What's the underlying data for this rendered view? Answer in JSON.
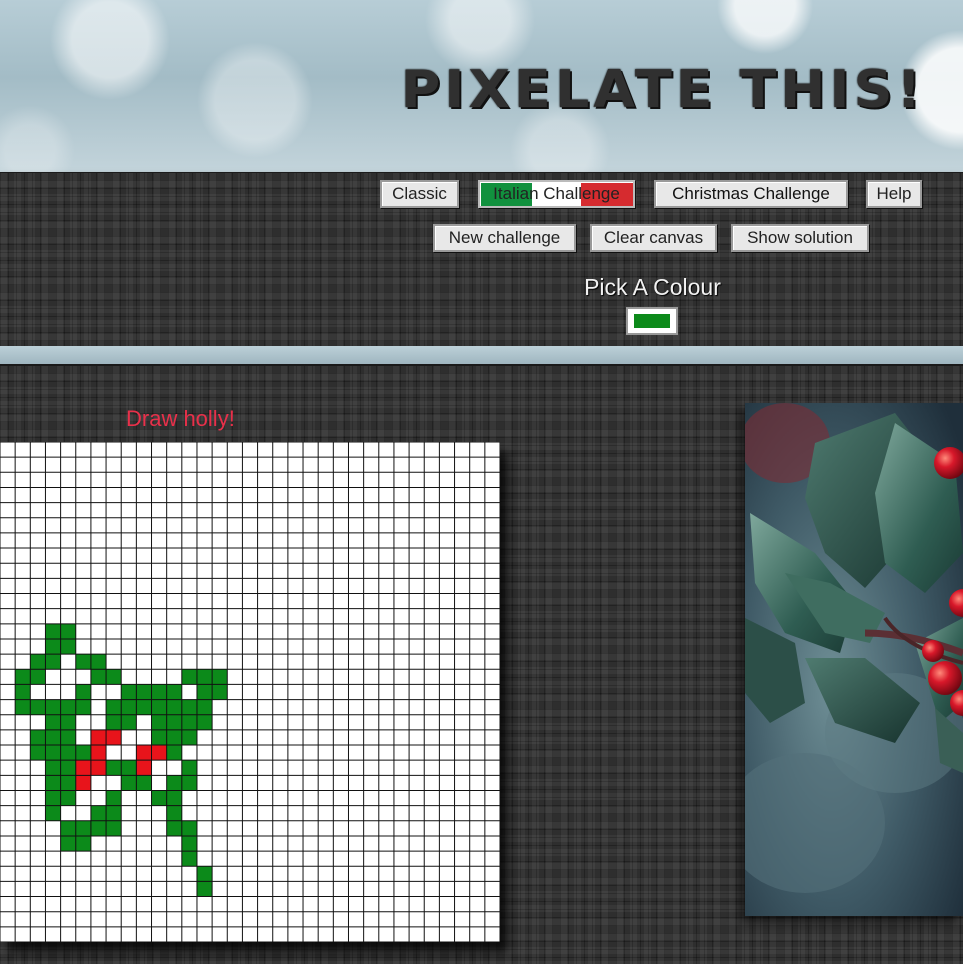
{
  "header": {
    "title": "PIXELATE THIS!"
  },
  "modes": [
    {
      "label": "Classic"
    },
    {
      "label": "Italian Challenge"
    },
    {
      "label": "Christmas Challenge"
    },
    {
      "label": "Help"
    }
  ],
  "actions": [
    {
      "label": "New challenge"
    },
    {
      "label": "Clear canvas"
    },
    {
      "label": "Show solution"
    }
  ],
  "palette": {
    "label": "Pick A Colour",
    "selected_color": "#0c8a1a"
  },
  "challenge": {
    "prompt": "Draw holly!"
  },
  "colors": {
    "green": "#0c8a1a",
    "red": "#e8141b",
    "prompt": "#e8304a",
    "italian_green": "#11913e",
    "italian_red": "#d62b2f"
  },
  "canvas": {
    "cols": 33,
    "rows": 33,
    "painted": {
      "green": [
        [
          3,
          12
        ],
        [
          4,
          12
        ],
        [
          3,
          13
        ],
        [
          4,
          13
        ],
        [
          2,
          14
        ],
        [
          3,
          14
        ],
        [
          5,
          14
        ],
        [
          6,
          14
        ],
        [
          1,
          15
        ],
        [
          2,
          15
        ],
        [
          6,
          15
        ],
        [
          7,
          15
        ],
        [
          12,
          15
        ],
        [
          13,
          15
        ],
        [
          14,
          15
        ],
        [
          1,
          16
        ],
        [
          5,
          16
        ],
        [
          8,
          16
        ],
        [
          9,
          16
        ],
        [
          10,
          16
        ],
        [
          11,
          16
        ],
        [
          13,
          16
        ],
        [
          14,
          16
        ],
        [
          1,
          17
        ],
        [
          2,
          17
        ],
        [
          3,
          17
        ],
        [
          4,
          17
        ],
        [
          5,
          17
        ],
        [
          7,
          17
        ],
        [
          8,
          17
        ],
        [
          9,
          17
        ],
        [
          10,
          17
        ],
        [
          11,
          17
        ],
        [
          12,
          17
        ],
        [
          13,
          17
        ],
        [
          3,
          18
        ],
        [
          4,
          18
        ],
        [
          7,
          18
        ],
        [
          8,
          18
        ],
        [
          10,
          18
        ],
        [
          11,
          18
        ],
        [
          12,
          18
        ],
        [
          13,
          18
        ],
        [
          2,
          19
        ],
        [
          3,
          19
        ],
        [
          4,
          19
        ],
        [
          10,
          19
        ],
        [
          11,
          19
        ],
        [
          12,
          19
        ],
        [
          2,
          20
        ],
        [
          3,
          20
        ],
        [
          4,
          20
        ],
        [
          5,
          20
        ],
        [
          10,
          20
        ],
        [
          11,
          20
        ],
        [
          3,
          21
        ],
        [
          4,
          21
        ],
        [
          7,
          21
        ],
        [
          8,
          21
        ],
        [
          9,
          21
        ],
        [
          12,
          21
        ],
        [
          3,
          22
        ],
        [
          4,
          22
        ],
        [
          8,
          22
        ],
        [
          9,
          22
        ],
        [
          11,
          22
        ],
        [
          12,
          22
        ],
        [
          3,
          23
        ],
        [
          4,
          23
        ],
        [
          7,
          23
        ],
        [
          10,
          23
        ],
        [
          11,
          23
        ],
        [
          3,
          24
        ],
        [
          6,
          24
        ],
        [
          7,
          24
        ],
        [
          11,
          24
        ],
        [
          4,
          25
        ],
        [
          5,
          25
        ],
        [
          6,
          25
        ],
        [
          7,
          25
        ],
        [
          11,
          25
        ],
        [
          12,
          25
        ],
        [
          4,
          26
        ],
        [
          5,
          26
        ],
        [
          12,
          26
        ],
        [
          12,
          27
        ],
        [
          13,
          28
        ],
        [
          13,
          29
        ]
      ],
      "red": [
        [
          6,
          19
        ],
        [
          7,
          19
        ],
        [
          6,
          20
        ],
        [
          9,
          20
        ],
        [
          10,
          20
        ],
        [
          9,
          21
        ],
        [
          5,
          21
        ],
        [
          6,
          21
        ],
        [
          5,
          22
        ]
      ]
    }
  }
}
